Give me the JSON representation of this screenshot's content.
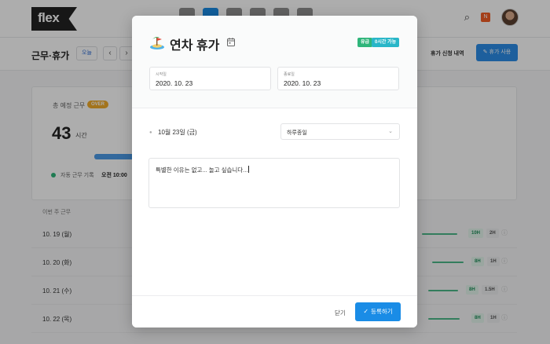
{
  "app": {
    "logo_text": "flex",
    "page_title": "근무·휴가",
    "today_label": "오늘",
    "nav_prev": "‹",
    "nav_next": "›",
    "notification_count": "N",
    "history_label": "휴가 신청 내역",
    "use_leave_label": "휴가 사용"
  },
  "summary_card": {
    "label": "총 예정 근무",
    "badge": "OVER",
    "hours": "43",
    "hours_unit": "시간",
    "auto_record_label": "자동 근무 기록",
    "auto_record_time": "오전 10:00"
  },
  "week": {
    "label": "이번 주 근무",
    "days": [
      {
        "date": "10. 19 (월)",
        "pill_a": "10H",
        "pill_b": "2H"
      },
      {
        "date": "10. 20 (화)",
        "pill_a": "8H",
        "pill_b": "1H"
      },
      {
        "date": "10. 21 (수)",
        "pill_a": "8H",
        "pill_b": "1.5H"
      },
      {
        "date": "10. 22 (목)",
        "pill_a": "8H",
        "pill_b": "1H"
      }
    ]
  },
  "modal": {
    "title": "연차 휴가",
    "badge_paid": "유급",
    "badge_available": "0시간 가능",
    "start_label": "시작일",
    "start_value": "2020. 10. 23",
    "end_label": "종료일",
    "end_value": "2020. 10. 23",
    "day_label": "10월 23일 (금)",
    "duration_value": "하루종일",
    "reason_text": "특별한 이유는 없고... 놀고 싶습니다...",
    "close_label": "닫기",
    "submit_label": "등록하기"
  },
  "colors": {
    "accent": "#1a8ce6",
    "paid": "#2fb57a",
    "available": "#28b6c8",
    "over": "#f1ac2b"
  }
}
